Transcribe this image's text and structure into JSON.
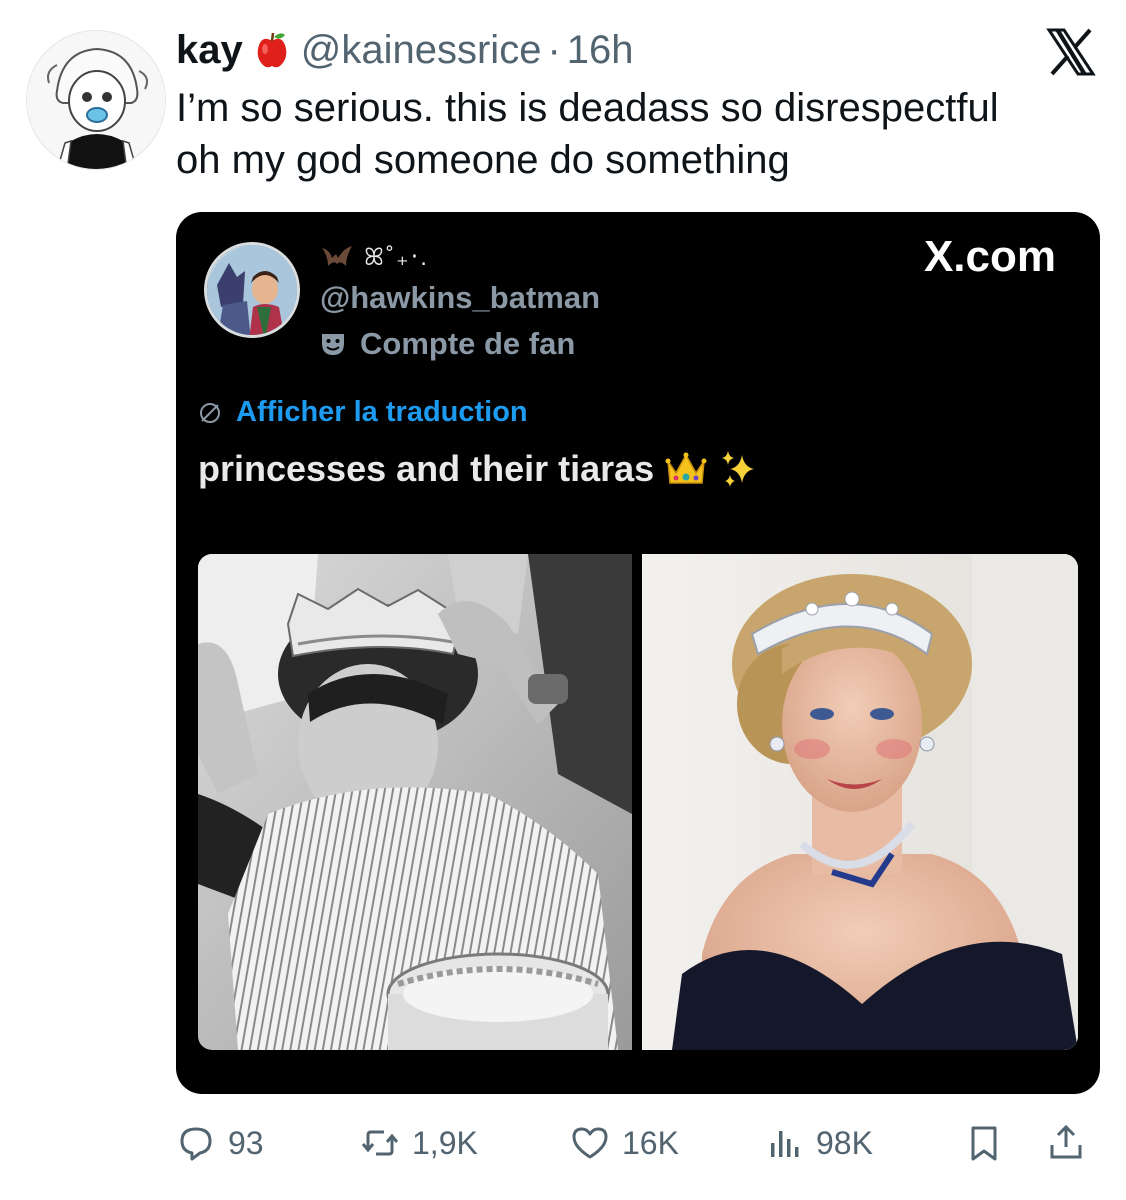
{
  "tweet": {
    "display_name": "kay",
    "badge_icon": "red-apple-icon",
    "handle": "@kainessrice",
    "separator": "·",
    "time": "16h",
    "platform_icon": "x-logo-icon",
    "text_lines": [
      "I’m so serious. this is deadass so disrespectful",
      "oh my god someone do something"
    ]
  },
  "quoted": {
    "name_glyphs": "ꕤ˚₊‧.",
    "handle": "@hawkins_batman",
    "account_label": "Compte de fan",
    "site": "X.com",
    "translate_label": "Afficher la traduction",
    "text": "princesses and their tiaras",
    "emojis": [
      "crown-emoji",
      "sparkles-emoji"
    ],
    "photos": [
      "black-and-white-photo-boy-with-crown",
      "color-photo-woman-with-tiara"
    ]
  },
  "actions": {
    "replies": "93",
    "reposts": "1,9K",
    "likes": "16K",
    "views": "98K"
  },
  "colors": {
    "text": "#0f1419",
    "muted": "#536471",
    "link": "#1d9bf0",
    "card_bg": "#000000"
  }
}
